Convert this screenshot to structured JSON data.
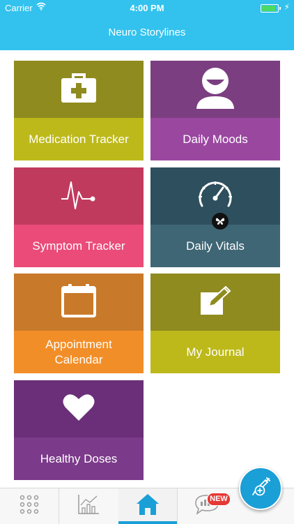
{
  "status_bar": {
    "carrier": "Carrier",
    "time": "4:00 PM"
  },
  "header": {
    "title": "Neuro Storylines"
  },
  "tiles": [
    {
      "label": "Medication Tracker",
      "icon": "medical-kit-icon",
      "top_color": "#8f8b1f",
      "bottom_color": "#bdb91b"
    },
    {
      "label": "Daily Moods",
      "icon": "smiling-face-icon",
      "top_color": "#7b3e80",
      "bottom_color": "#9a47a0"
    },
    {
      "label": "Symptom Tracker",
      "icon": "heartbeat-line-icon",
      "top_color": "#c03a5e",
      "bottom_color": "#ea4b79"
    },
    {
      "label": "Daily Vitals",
      "icon": "speedometer-gauge-icon",
      "top_color": "#2e4f5d",
      "bottom_color": "#3f6675"
    },
    {
      "label": "Appointment Calendar",
      "label_line1": "Appointment",
      "label_line2": "Calendar",
      "icon": "calendar-icon",
      "top_color": "#c9792a",
      "bottom_color": "#f28e28"
    },
    {
      "label": "My Journal",
      "icon": "notepad-pencil-icon",
      "top_color": "#8f8b1f",
      "bottom_color": "#bdb91b"
    },
    {
      "label": "Healthy Doses",
      "icon": "heart-icon",
      "top_color": "#6a2f78",
      "bottom_color": "#7b3a8a"
    }
  ],
  "tab_bar": {
    "items": [
      "grid-menu-icon",
      "bar-chart-icon",
      "home-icon",
      "chat-bubble-icon"
    ],
    "active": "home-icon",
    "badge": "NEW",
    "accent": "#1a9fd6"
  },
  "fab": {
    "icon": "syringe-plus-icon"
  }
}
